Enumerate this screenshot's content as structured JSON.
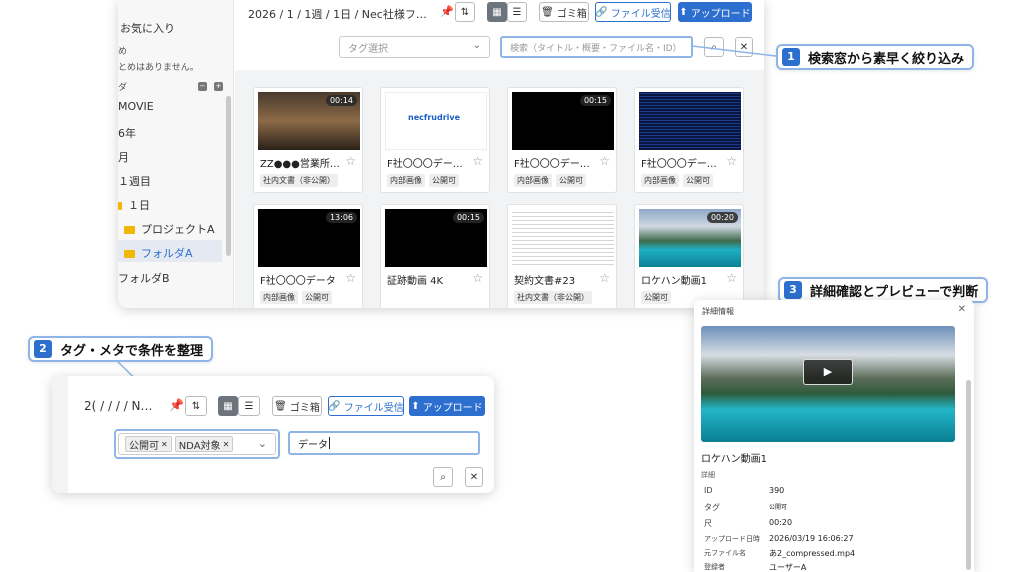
{
  "sidebar": {
    "favorites": "お気に入り",
    "fav_line1": "め",
    "fav_line2": "とめはありません。",
    "folders": "ダ",
    "items": [
      "MOVIE",
      "6年",
      "月",
      "１週目",
      "１日"
    ],
    "sub_items": [
      "プロジェクトA",
      "フォルダA"
    ],
    "last_item": "フォルダB"
  },
  "toolbar": {
    "breadcrumb": "2026 / 1 / 1週 / 1日 / Nec社様フ…",
    "trash": "ゴミ箱",
    "receive": "ファイル受信",
    "upload": "アップロード"
  },
  "filters": {
    "tag_placeholder": "タグ選択",
    "search_placeholder": "検索（タイトル・概要・ファイル名・ID）"
  },
  "cards": [
    {
      "title": "ZZ●●●営業所増…",
      "duration": "00:14",
      "tags": [
        "社内文書（非公開）"
      ]
    },
    {
      "title": "F社〇〇〇デー…",
      "duration": "",
      "tags": [
        "内部画像",
        "公開可"
      ],
      "thumb_brand": "necfrudrive"
    },
    {
      "title": "F社〇〇〇デー…",
      "duration": "00:15",
      "tags": [
        "内部画像",
        "公開可"
      ]
    },
    {
      "title": "F社〇〇〇デー…",
      "duration": "",
      "tags": [
        "内部画像",
        "公開可"
      ]
    },
    {
      "title": "F社〇〇〇データ",
      "duration": "13:06",
      "tags": [
        "内部画像",
        "公開可"
      ]
    },
    {
      "title": "証跡動画 4K",
      "duration": "00:15",
      "tags": []
    },
    {
      "title": "契約文書#23",
      "duration": "",
      "tags": [
        "社内文書（非公開）"
      ]
    },
    {
      "title": "ロケハン動画1",
      "duration": "00:20",
      "tags": [
        "公開可"
      ]
    }
  ],
  "callouts": [
    {
      "num": "1",
      "text": "検索窓から素早く絞り込み"
    },
    {
      "num": "2",
      "text": "タグ・メタで条件を整理"
    },
    {
      "num": "3",
      "text": "詳細確認とプレビューで判断"
    }
  ],
  "zoom": {
    "breadcrumb": "2( /  /  /  / N…",
    "trash": "ゴミ箱",
    "receive": "ファイル受信",
    "upload": "アップロード",
    "chips": [
      "公開可",
      "NDA対象"
    ],
    "search_value": "データ"
  },
  "detail": {
    "header": "詳細情報",
    "title": "ロケハン動画1",
    "section": "詳細",
    "rows": [
      {
        "k": "ID",
        "v": "390"
      },
      {
        "k": "タグ",
        "v": "公開可"
      },
      {
        "k": "尺",
        "v": "00:20"
      },
      {
        "k": "アップロード日時",
        "v": "2026/03/19 16:06:27"
      },
      {
        "k": "元ファイル名",
        "v": "あ2_compressed.mp4"
      },
      {
        "k": "登録者",
        "v": "ユーザーA"
      }
    ]
  },
  "colors": {
    "accent": "#2d6fce",
    "callout_border": "#8fb4e8"
  }
}
